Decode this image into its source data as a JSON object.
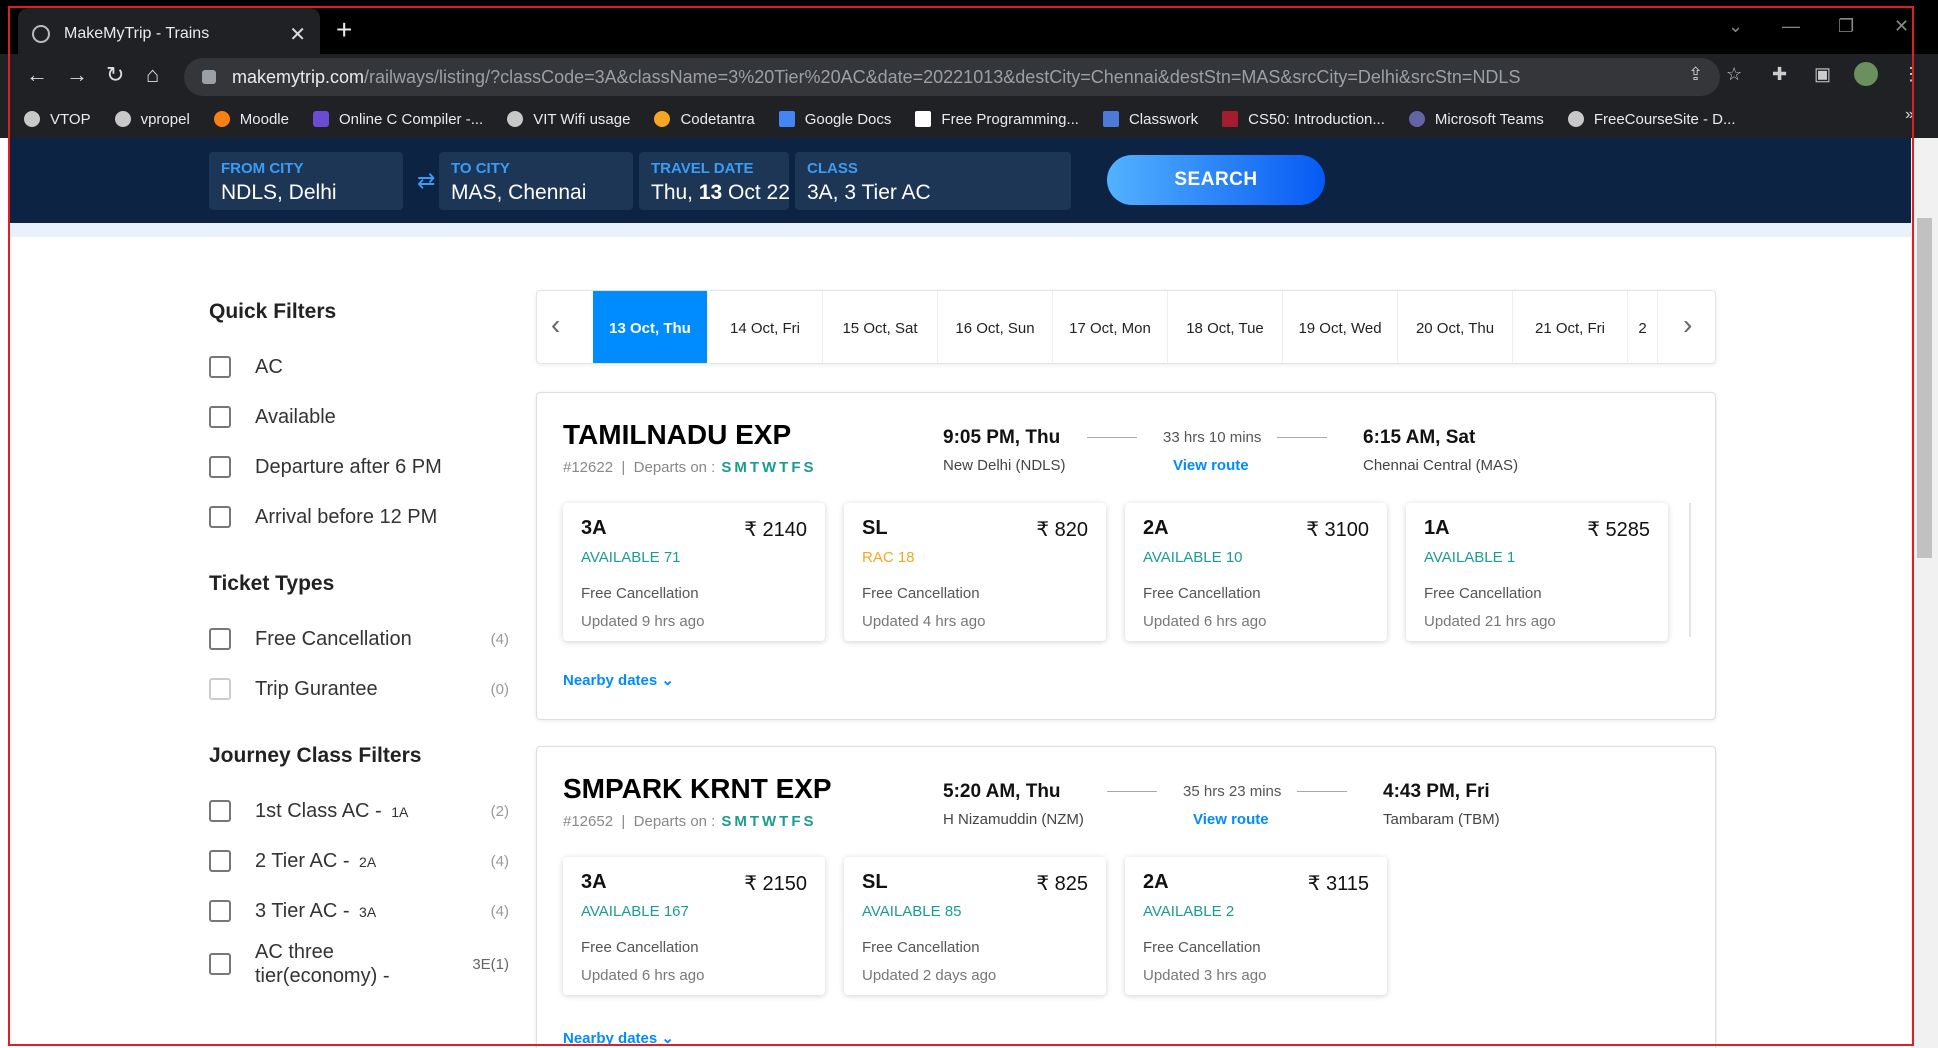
{
  "browser": {
    "tab_title": "MakeMyTrip - Trains",
    "url_host": "makemytrip.com",
    "url_path": "/railways/listing/?classCode=3A&className=3%20Tier%20AC&date=20221013&destCity=Chennai&destStn=MAS&srcCity=Delhi&srcStn=NDLS",
    "bookmarks": [
      "VTOP",
      "vpropel",
      "Moodle",
      "Online C Compiler -...",
      "VIT Wifi usage",
      "Codetantra",
      "Google Docs",
      "Free Programming...",
      "Classwork",
      "CS50: Introduction...",
      "Microsoft Teams",
      "FreeCourseSite - D..."
    ],
    "icons": [
      "globe-icon",
      "close-icon",
      "plus-icon",
      "back-icon",
      "forward-icon",
      "reload-icon",
      "home-icon",
      "lock-icon",
      "share-icon",
      "star-icon",
      "extensions-icon",
      "sidepanel-icon",
      "profile-avatar",
      "menu-icon"
    ]
  },
  "search": {
    "from_label": "FROM CITY",
    "from_value": "NDLS, Delhi",
    "to_label": "TO CITY",
    "to_value": "MAS, Chennai",
    "date_label": "TRAVEL DATE",
    "date_prefix": "Thu, ",
    "date_day": "13",
    "date_suffix": " Oct 22",
    "class_label": "CLASS",
    "class_value": "3A, 3 Tier AC",
    "button": "SEARCH",
    "colors": {
      "header_bg": "#0d2343",
      "accent": "#008cff",
      "available": "#1a9c8f",
      "rac": "#f5a623"
    }
  },
  "filters": {
    "quick_title": "Quick Filters",
    "quick": [
      "AC",
      "Available",
      "Departure after 6 PM",
      "Arrival before 12 PM"
    ],
    "ticket_title": "Ticket Types",
    "ticket": [
      {
        "label": "Free Cancellation",
        "count": "(4)"
      },
      {
        "label": "Trip Gurantee",
        "count": "(0)"
      }
    ],
    "class_title": "Journey Class Filters",
    "classes": [
      {
        "label": "1st Class AC - ",
        "code": "1A",
        "count": "(2)"
      },
      {
        "label": "2 Tier AC - ",
        "code": "2A",
        "count": "(4)"
      },
      {
        "label": "3 Tier AC - ",
        "code": "3A",
        "count": "(4)"
      },
      {
        "label": "AC three tier(economy) -",
        "code": "",
        "count": "3E(1)"
      }
    ]
  },
  "dates": [
    "13 Oct, Thu",
    "14 Oct, Fri",
    "15 Oct, Sat",
    "16 Oct, Sun",
    "17 Oct, Mon",
    "18 Oct, Tue",
    "19 Oct, Wed",
    "20 Oct, Thu",
    "21 Oct, Fri",
    "2"
  ],
  "trains": [
    {
      "name": "TAMILNADU EXP",
      "number": "#12622",
      "departs_label": "Departs on :",
      "days": "SMTWTFS",
      "dep_time": "9:05 PM, Thu",
      "dep_station": "New Delhi (NDLS)",
      "duration": "33 hrs 10 mins",
      "view_route": "View route",
      "arr_time": "6:15 AM, Sat",
      "arr_station": "Chennai Central (MAS)",
      "fares": [
        {
          "cls": "3A",
          "price": "₹ 2140",
          "avail": "AVAILABLE 71",
          "fc": "Free Cancellation",
          "updated": "Updated 9 hrs ago"
        },
        {
          "cls": "SL",
          "price": "₹ 820",
          "avail": "RAC 18",
          "fc": "Free Cancellation",
          "updated": "Updated 4 hrs ago"
        },
        {
          "cls": "2A",
          "price": "₹ 3100",
          "avail": "AVAILABLE 10",
          "fc": "Free Cancellation",
          "updated": "Updated 6 hrs ago"
        },
        {
          "cls": "1A",
          "price": "₹ 5285",
          "avail": "AVAILABLE 1",
          "fc": "Free Cancellation",
          "updated": "Updated 21 hrs ago"
        }
      ],
      "nearby": "Nearby dates"
    },
    {
      "name": "SMPARK KRNT EXP",
      "number": "#12652",
      "departs_label": "Departs on :",
      "days": "SMTWTFS",
      "dep_time": "5:20 AM, Thu",
      "dep_station": "H Nizamuddin (NZM)",
      "duration": "35 hrs 23 mins",
      "view_route": "View route",
      "arr_time": "4:43 PM, Fri",
      "arr_station": "Tambaram (TBM)",
      "fares": [
        {
          "cls": "3A",
          "price": "₹ 2150",
          "avail": "AVAILABLE 167",
          "fc": "Free Cancellation",
          "updated": "Updated 6 hrs ago"
        },
        {
          "cls": "SL",
          "price": "₹ 825",
          "avail": "AVAILABLE 85",
          "fc": "Free Cancellation",
          "updated": "Updated 2 days ago"
        },
        {
          "cls": "2A",
          "price": "₹ 3115",
          "avail": "AVAILABLE 2",
          "fc": "Free Cancellation",
          "updated": "Updated 3 hrs ago"
        }
      ],
      "nearby": "Nearby dates"
    }
  ]
}
